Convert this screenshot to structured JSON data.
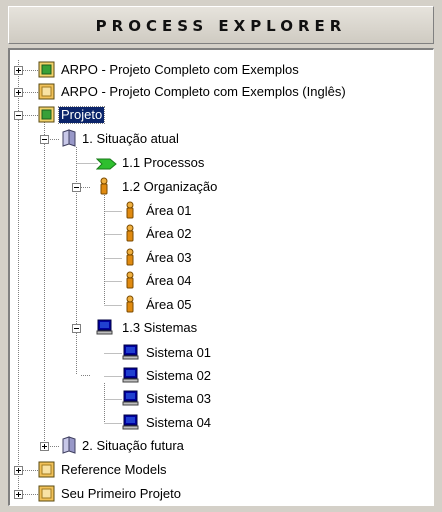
{
  "header": {
    "title": "PROCESS EXPLORER"
  },
  "tree": {
    "nodes": [
      {
        "label": "ARPO - Projeto Completo com Exemplos"
      },
      {
        "label": "ARPO - Projeto Completo com Exemplos (Inglês)"
      },
      {
        "label": "Projeto",
        "selected": true
      },
      {
        "label": "1. Situação atual"
      },
      {
        "label": "1.1 Processos"
      },
      {
        "label": "1.2 Organização"
      },
      {
        "label": "Área 01"
      },
      {
        "label": "Área 02"
      },
      {
        "label": "Área 03"
      },
      {
        "label": "Área 04"
      },
      {
        "label": "Área 05"
      },
      {
        "label": "1.3 Sistemas"
      },
      {
        "label": "Sistema 01"
      },
      {
        "label": "Sistema 02"
      },
      {
        "label": "Sistema 03"
      },
      {
        "label": "Sistema 04"
      },
      {
        "label": "2. Situação futura"
      },
      {
        "label": "Reference Models"
      },
      {
        "label": "Seu Primeiro Projeto"
      }
    ]
  },
  "icons": {
    "project_closed": "project-book-icon",
    "project_open": "project-book-open-icon",
    "folder": "folder-icon",
    "process": "process-arrow-icon",
    "organization": "person-icon",
    "system": "computer-icon"
  },
  "colors": {
    "selection": "#0a246a",
    "process_arrow": "#2fbf2f",
    "person": "#e08a10",
    "system": "#0000a0"
  }
}
